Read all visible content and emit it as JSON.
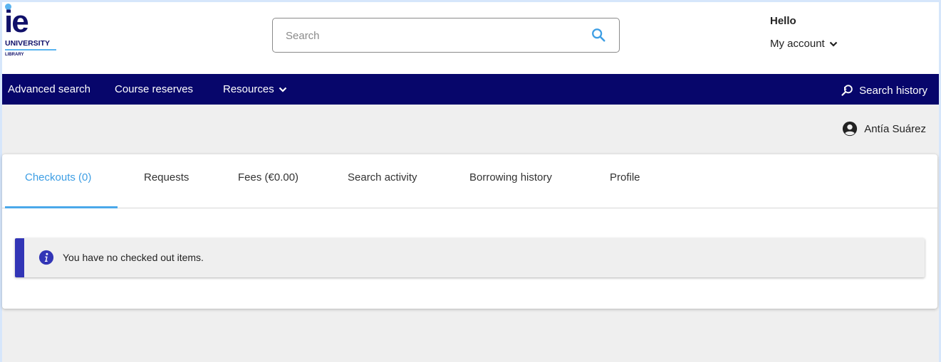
{
  "header": {
    "logo": {
      "brand": "ie",
      "line1": "UNIVERSITY",
      "line2": "LIBRARY"
    },
    "search": {
      "placeholder": "Search",
      "value": ""
    },
    "greeting": "Hello",
    "account_label": "My account"
  },
  "nav": {
    "items": [
      {
        "label": "Advanced search"
      },
      {
        "label": "Course reserves"
      },
      {
        "label": "Resources"
      }
    ],
    "search_history": "Search history"
  },
  "user": {
    "name": "Antía Suárez"
  },
  "tabs": [
    {
      "label": "Checkouts (0)",
      "active": true
    },
    {
      "label": "Requests"
    },
    {
      "label": "Fees (€0.00)"
    },
    {
      "label": "Search activity"
    },
    {
      "label": "Borrowing history"
    },
    {
      "label": "Profile"
    }
  ],
  "alert": {
    "message": "You have no checked out items."
  },
  "colors": {
    "nav": "#07066b",
    "accent": "#4aa8ea",
    "brand": "#10106a",
    "alert_bar": "#3235b6"
  }
}
